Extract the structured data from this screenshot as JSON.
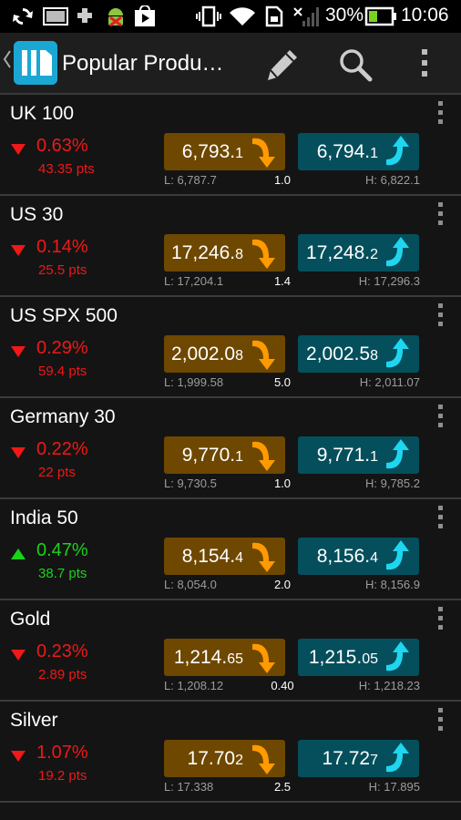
{
  "status_bar": {
    "icons_left": [
      "sync-icon",
      "image-icon",
      "puzzle-icon",
      "android-debug-icon",
      "play-store-icon"
    ],
    "icons_right": [
      "vibrate-icon",
      "wifi-icon",
      "sim-icon",
      "signal-icon",
      "battery-icon"
    ],
    "battery_percent": "30%",
    "time": "10:06",
    "colors": {
      "battery": "#7bd320"
    }
  },
  "action_bar": {
    "title": "Popular Produ…",
    "icons": [
      "back-chevron-icon",
      "app-logo-icon",
      "edit-pencil-icon",
      "search-icon",
      "overflow-menu-icon"
    ]
  },
  "colors": {
    "sell_bg": "#6e4800",
    "buy_bg": "#054f5c",
    "sell_arrow": "#ff9a00",
    "buy_arrow": "#1fd6f0",
    "down": "#f01818",
    "up": "#1ad219"
  },
  "products": [
    {
      "name": "UK 100",
      "direction": "down",
      "pct": "0.63%",
      "pts": "43.35 pts",
      "sell_main": "6,793.",
      "sell_small": "1",
      "buy_main": "6,794.",
      "buy_small": "1",
      "low": "L: 6,787.7",
      "spread": "1.0",
      "high": "H: 6,822.1"
    },
    {
      "name": "US 30",
      "direction": "down",
      "pct": "0.14%",
      "pts": "25.5 pts",
      "sell_main": "17,246.",
      "sell_small": "8",
      "buy_main": "17,248.",
      "buy_small": "2",
      "low": "L: 17,204.1",
      "spread": "1.4",
      "high": "H: 17,296.3"
    },
    {
      "name": "US SPX 500",
      "direction": "down",
      "pct": "0.29%",
      "pts": "59.4 pts",
      "sell_main": "2,002.0",
      "sell_small": "8",
      "buy_main": "2,002.5",
      "buy_small": "8",
      "low": "L: 1,999.58",
      "spread": "5.0",
      "high": "H: 2,011.07"
    },
    {
      "name": "Germany 30",
      "direction": "down",
      "pct": "0.22%",
      "pts": "22 pts",
      "sell_main": "9,770.",
      "sell_small": "1",
      "buy_main": "9,771.",
      "buy_small": "1",
      "low": "L: 9,730.5",
      "spread": "1.0",
      "high": "H: 9,785.2"
    },
    {
      "name": "India 50",
      "direction": "up",
      "pct": "0.47%",
      "pts": "38.7 pts",
      "sell_main": "8,154.",
      "sell_small": "4",
      "buy_main": "8,156.",
      "buy_small": "4",
      "low": "L: 8,054.0",
      "spread": "2.0",
      "high": "H: 8,156.9"
    },
    {
      "name": "Gold",
      "direction": "down",
      "pct": "0.23%",
      "pts": "2.89 pts",
      "sell_main": "1,214.",
      "sell_small": "65",
      "buy_main": "1,215.",
      "buy_small": "05",
      "low": "L: 1,208.12",
      "spread": "0.40",
      "high": "H: 1,218.23"
    },
    {
      "name": "Silver",
      "direction": "down",
      "pct": "1.07%",
      "pts": "19.2 pts",
      "sell_main": "17.70",
      "sell_small": "2",
      "buy_main": "17.72",
      "buy_small": "7",
      "low": "L: 17.338",
      "spread": "2.5",
      "high": "H: 17.895"
    }
  ]
}
